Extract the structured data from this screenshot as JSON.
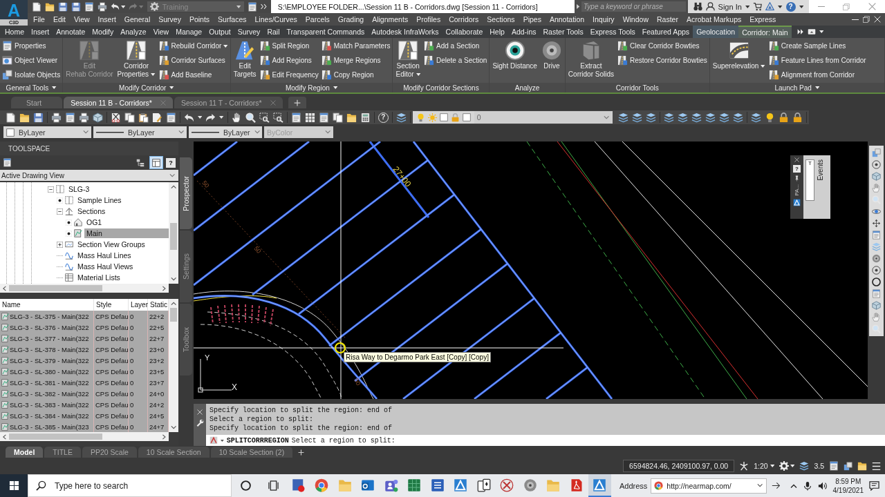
{
  "app_button": {
    "glyph": "A",
    "label": "C3D"
  },
  "quick_access": {
    "workspace": "Training",
    "undo": {
      "disabled": false
    },
    "redo": {
      "disabled": true
    }
  },
  "title_bar": {
    "title": "S:\\EMPLOYEE FOLDER...\\Session 11 B - Corridors.dwg [Session 11 - Corridors]",
    "search": {
      "placeholder": "Type a keyword or phrase"
    },
    "sign_in": "Sign In",
    "help": "?"
  },
  "menu_bar": [
    "File",
    "Edit",
    "View",
    "Insert",
    "General",
    "Survey",
    "Points",
    "Surfaces",
    "Lines/Curves",
    "Parcels",
    "Grading",
    "Alignments",
    "Profiles",
    "Corridors",
    "Sections",
    "Pipes",
    "Annotation",
    "Inquiry",
    "Window",
    "Raster",
    "Acrobat Markups",
    "Express"
  ],
  "ribbon_tabs": [
    {
      "label": "Home",
      "selected": false,
      "contextual": false
    },
    {
      "label": "Insert",
      "selected": false,
      "contextual": false
    },
    {
      "label": "Annotate",
      "selected": false,
      "contextual": false
    },
    {
      "label": "Modify",
      "selected": false,
      "contextual": false
    },
    {
      "label": "Analyze",
      "selected": false,
      "contextual": false
    },
    {
      "label": "View",
      "selected": false,
      "contextual": false
    },
    {
      "label": "Manage",
      "selected": false,
      "contextual": false
    },
    {
      "label": "Output",
      "selected": false,
      "contextual": false
    },
    {
      "label": "Survey",
      "selected": false,
      "contextual": false
    },
    {
      "label": "Rail",
      "selected": false,
      "contextual": false
    },
    {
      "label": "Transparent Commands",
      "selected": false,
      "contextual": false
    },
    {
      "label": "Autodesk InfraWorks",
      "selected": false,
      "contextual": false
    },
    {
      "label": "Collaborate",
      "selected": false,
      "contextual": false
    },
    {
      "label": "Help",
      "selected": false,
      "contextual": false
    },
    {
      "label": "Add-ins",
      "selected": false,
      "contextual": false
    },
    {
      "label": "Raster Tools",
      "selected": false,
      "contextual": false
    },
    {
      "label": "Express Tools",
      "selected": false,
      "contextual": false
    },
    {
      "label": "Featured Apps",
      "selected": false,
      "contextual": false
    },
    {
      "label": "Geolocation",
      "selected": false,
      "contextual": true
    },
    {
      "label": "Corridor: Main",
      "selected": true,
      "contextual": true
    }
  ],
  "ribbon_panels": [
    {
      "title": "General Tools",
      "menu": true,
      "tools": [
        {
          "kind": "small",
          "label": "Properties",
          "disabled": false,
          "menu": false
        },
        {
          "kind": "small",
          "label": "Object Viewer",
          "disabled": false,
          "menu": false
        },
        {
          "kind": "small",
          "label": "Isolate Objects",
          "disabled": false,
          "menu": false
        }
      ]
    },
    {
      "title": "Modify Corridor",
      "menu": true,
      "tools": [
        {
          "kind": "large",
          "label": "Edit\nRehab Corridor",
          "disabled": true,
          "menu": false
        },
        {
          "kind": "large",
          "label": "Corridor\nProperties",
          "disabled": false,
          "menu": true
        },
        {
          "kind": "small",
          "label": "Rebuild Corridor",
          "disabled": false,
          "menu": true
        },
        {
          "kind": "small",
          "label": "Corridor Surfaces",
          "disabled": false,
          "menu": false
        },
        {
          "kind": "small",
          "label": "Add Baseline",
          "disabled": false,
          "menu": false
        }
      ]
    },
    {
      "title": "Modify Region",
      "menu": true,
      "tools": [
        {
          "kind": "large",
          "label": "Edit\nTargets",
          "disabled": false,
          "menu": false
        },
        {
          "kind": "small",
          "label": "Split Region",
          "disabled": false,
          "menu": false
        },
        {
          "kind": "small",
          "label": "Add Regions",
          "disabled": false,
          "menu": false
        },
        {
          "kind": "small",
          "label": "Edit Frequency",
          "disabled": false,
          "menu": false
        },
        {
          "kind": "small",
          "label": "Match Parameters",
          "disabled": false,
          "menu": false
        },
        {
          "kind": "small",
          "label": "Merge Regions",
          "disabled": false,
          "menu": false
        },
        {
          "kind": "small",
          "label": "Copy Region",
          "disabled": false,
          "menu": false
        }
      ]
    },
    {
      "title": "Modify Corridor Sections",
      "menu": false,
      "tools": [
        {
          "kind": "large",
          "label": "Section\nEditor",
          "disabled": false,
          "menu": true
        },
        {
          "kind": "small",
          "label": "Add a Section",
          "disabled": false,
          "menu": false
        },
        {
          "kind": "small",
          "label": "Delete a Section",
          "disabled": false,
          "menu": false
        }
      ]
    },
    {
      "title": "Analyze",
      "menu": false,
      "tools": [
        {
          "kind": "large",
          "label": "Sight Distance",
          "disabled": false,
          "menu": false
        },
        {
          "kind": "large",
          "label": "Drive",
          "disabled": false,
          "menu": false
        }
      ]
    },
    {
      "title": "Corridor Tools",
      "menu": false,
      "tools": [
        {
          "kind": "large",
          "label": "Extract\nCorridor Solids",
          "disabled": false,
          "menu": false
        },
        {
          "kind": "small",
          "label": "Clear Corridor Bowties",
          "disabled": false,
          "menu": false
        },
        {
          "kind": "small",
          "label": "Restore Corridor Bowties",
          "disabled": false,
          "menu": false
        }
      ]
    },
    {
      "title": "Launch Pad",
      "menu": true,
      "tools": [
        {
          "kind": "large",
          "label": "Superelevation",
          "disabled": false,
          "menu": true
        },
        {
          "kind": "small",
          "label": "Create Sample Lines",
          "disabled": false,
          "menu": false
        },
        {
          "kind": "small",
          "label": "Feature Lines from Corridor",
          "disabled": false,
          "menu": false
        },
        {
          "kind": "small",
          "label": "Alignment from Corridor",
          "disabled": false,
          "menu": false
        }
      ]
    }
  ],
  "doc_tabs": [
    {
      "label": "Start",
      "selected": false,
      "closable": false
    },
    {
      "label": "Session 11 B - Corridors*",
      "selected": true,
      "closable": true
    },
    {
      "label": "Session 11 T - Corridors*",
      "selected": false,
      "closable": true
    }
  ],
  "toolbar": {
    "help": "?",
    "layer": "0"
  },
  "properties_bar": [
    {
      "kind": "color",
      "value": "ByLayer",
      "disabled": false
    },
    {
      "kind": "linetype",
      "value": "ByLayer",
      "disabled": false
    },
    {
      "kind": "lineweight",
      "value": "ByLayer",
      "disabled": false
    },
    {
      "kind": "plotstyle",
      "value": "ByColor",
      "disabled": true
    }
  ],
  "toolspace": {
    "title": "TOOLSPACE",
    "toggles": [
      {
        "selected": false
      },
      {
        "selected": true
      }
    ],
    "help": "?",
    "view": "Active Drawing View",
    "tree": [
      {
        "label": "SLG-3",
        "kind": "open",
        "selected": false,
        "children": [
          {
            "label": "Sample Lines",
            "kind": "dot",
            "selected": false
          },
          {
            "label": "Sections",
            "kind": "open",
            "selected": false,
            "children": [
              {
                "label": "OG1",
                "kind": "dot",
                "selected": false
              },
              {
                "label": "Main",
                "kind": "dot",
                "selected": true
              }
            ]
          },
          {
            "label": "Section View Groups",
            "kind": "closed",
            "selected": false
          },
          {
            "label": "Mass Haul Lines",
            "kind": "plain",
            "selected": false
          },
          {
            "label": "Mass Haul Views",
            "kind": "plain",
            "selected": false
          },
          {
            "label": "Material Lists",
            "kind": "plain",
            "selected": false
          }
        ]
      }
    ],
    "list": {
      "columns": [
        "Name",
        "Style",
        "Layer",
        "Static"
      ],
      "rows": [
        {
          "cells": [
            "SLG-3 - SL-375 - Main(322",
            "CPS Defau",
            "0",
            "22+2"
          ],
          "selected": true
        },
        {
          "cells": [
            "SLG-3 - SL-376 - Main(322",
            "CPS Defau",
            "0",
            "22+5"
          ],
          "selected": true
        },
        {
          "cells": [
            "SLG-3 - SL-377 - Main(322",
            "CPS Defau",
            "0",
            "22+7"
          ],
          "selected": true
        },
        {
          "cells": [
            "SLG-3 - SL-378 - Main(322",
            "CPS Defau",
            "0",
            "23+0"
          ],
          "selected": true
        },
        {
          "cells": [
            "SLG-3 - SL-379 - Main(322",
            "CPS Defau",
            "0",
            "23+2"
          ],
          "selected": true
        },
        {
          "cells": [
            "SLG-3 - SL-380 - Main(322",
            "CPS Defau",
            "0",
            "23+5"
          ],
          "selected": true
        },
        {
          "cells": [
            "SLG-3 - SL-381 - Main(322",
            "CPS Defau",
            "0",
            "23+7"
          ],
          "selected": true
        },
        {
          "cells": [
            "SLG-3 - SL-382 - Main(322",
            "CPS Defau",
            "0",
            "24+0"
          ],
          "selected": true
        },
        {
          "cells": [
            "SLG-3 - SL-383 - Main(322",
            "CPS Defau",
            "0",
            "24+2"
          ],
          "selected": true
        },
        {
          "cells": [
            "SLG-3 - SL-384 - Main(322",
            "CPS Defau",
            "0",
            "24+5"
          ],
          "selected": true
        },
        {
          "cells": [
            "SLG-3 - SL-385 - Main(323",
            "CPS Defau",
            "0",
            "24+7"
          ],
          "selected": true
        }
      ]
    },
    "side_tabs": [
      {
        "label": "Prospector",
        "selected": true
      },
      {
        "label": "Settings",
        "selected": false
      },
      {
        "label": "Toolbox",
        "selected": false
      }
    ]
  },
  "drawing": {
    "labels": [
      {
        "text": "27+00",
        "kind": "station"
      },
      {
        "text": "50",
        "kind": "offset"
      },
      {
        "text": "50",
        "kind": "offset"
      },
      {
        "text": "50",
        "kind": "offset"
      }
    ],
    "tooltip": "Risa Way to Degarmo Park East [Copy] [Copy]",
    "ucs": {
      "x": "X",
      "y": "Y"
    }
  },
  "events_palette": {
    "title": "Events",
    "help": "?",
    "field_label": "T",
    "label": "PA..."
  },
  "command_line": {
    "history": [
      "Specify location to split the region: end of",
      "Select a region to split:",
      "Specify location to split the region: end of"
    ],
    "command": "SPLITCORRREGION",
    "prompt": "Select a region to split:"
  },
  "layout_tabs": [
    {
      "label": "Model",
      "selected": true
    },
    {
      "label": "TITLE",
      "selected": false
    },
    {
      "label": "PP20 Scale",
      "selected": false
    },
    {
      "label": "10 Scale Section",
      "selected": false
    },
    {
      "label": "10 Scale Section (2)",
      "selected": false
    }
  ],
  "status_bar": {
    "coordinates": "6594824.46, 2409100.97, 0.00",
    "scale": "1:20",
    "value": "3.5"
  },
  "taskbar": {
    "search": {
      "placeholder": "Type here to search"
    },
    "apps": [
      {
        "active": false
      },
      {
        "active": false
      },
      {
        "active": false
      },
      {
        "active": false
      },
      {
        "active": false
      },
      {
        "active": false
      },
      {
        "active": false
      },
      {
        "active": false
      },
      {
        "active": false
      },
      {
        "active": false
      },
      {
        "active": false
      },
      {
        "active": false
      },
      {
        "active": false
      },
      {
        "active": true
      }
    ],
    "address_label": "Address",
    "address": {
      "value": "http://nearmap.com/"
    },
    "time": "8:59 PM",
    "date": "4/19/2021"
  }
}
